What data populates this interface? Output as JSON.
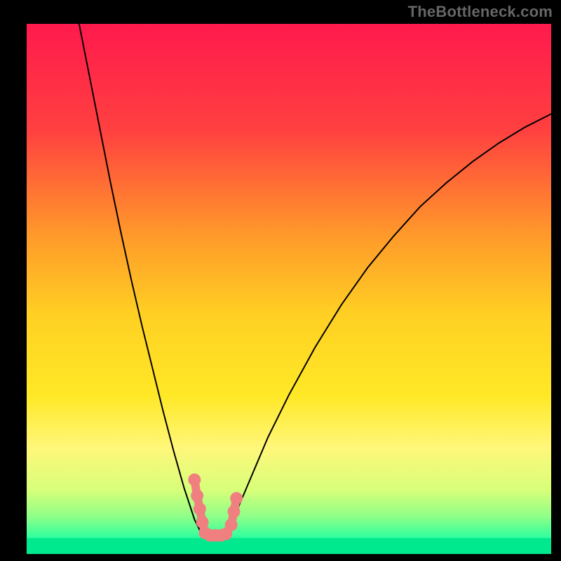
{
  "watermark": "TheBottleneck.com",
  "chart_data": {
    "type": "line",
    "title": "",
    "xlabel": "",
    "ylabel": "",
    "xlim": [
      0,
      100
    ],
    "ylim": [
      0,
      100
    ],
    "grid": false,
    "legend": false,
    "background": {
      "type": "vertical-gradient",
      "stops": [
        {
          "offset": 0.0,
          "color": "#ff1a4d"
        },
        {
          "offset": 0.2,
          "color": "#ff4040"
        },
        {
          "offset": 0.4,
          "color": "#ff9a2a"
        },
        {
          "offset": 0.55,
          "color": "#ffd023"
        },
        {
          "offset": 0.7,
          "color": "#ffe826"
        },
        {
          "offset": 0.8,
          "color": "#fff77a"
        },
        {
          "offset": 0.88,
          "color": "#d7ff7a"
        },
        {
          "offset": 0.93,
          "color": "#8dff88"
        },
        {
          "offset": 0.97,
          "color": "#2dff9f"
        },
        {
          "offset": 1.0,
          "color": "#00e98f"
        }
      ]
    },
    "series": [
      {
        "name": "bottleneck-curve-left",
        "color": "#000000",
        "width": 2,
        "x": [
          10,
          12,
          14,
          16,
          18,
          20,
          22,
          24,
          26,
          28,
          30,
          32,
          33.5
        ],
        "y": [
          100,
          90,
          80,
          70,
          60.5,
          51.5,
          43,
          35,
          27,
          19.5,
          12.5,
          6.5,
          3.5
        ]
      },
      {
        "name": "bottleneck-curve-right",
        "color": "#000000",
        "width": 2,
        "x": [
          38,
          40,
          43,
          46,
          50,
          55,
          60,
          65,
          70,
          75,
          80,
          85,
          90,
          95,
          100
        ],
        "y": [
          3,
          8,
          15,
          22,
          30,
          39,
          47,
          54,
          60,
          65.5,
          70,
          74,
          77.5,
          80.5,
          83
        ]
      }
    ],
    "highlight": {
      "name": "optimal-range-marker",
      "color": "#f08080",
      "width": 12,
      "points_xy": [
        [
          32.0,
          14.0
        ],
        [
          32.5,
          11.0
        ],
        [
          33.0,
          8.5
        ],
        [
          33.5,
          6.0
        ],
        [
          34.0,
          4.0
        ],
        [
          35.0,
          3.5
        ],
        [
          36.0,
          3.5
        ],
        [
          37.0,
          3.5
        ],
        [
          38.0,
          3.8
        ],
        [
          39.0,
          5.5
        ],
        [
          39.5,
          8.0
        ],
        [
          40.0,
          10.5
        ]
      ]
    },
    "baseline": {
      "name": "green-band",
      "y_range": [
        0,
        3
      ],
      "color": "#00e98f"
    },
    "notes": "V-shaped bottleneck curve with minimum around x≈34–38 reaching near y≈3. Values estimated from pixel positions; chart has no visible axis ticks or labels."
  }
}
